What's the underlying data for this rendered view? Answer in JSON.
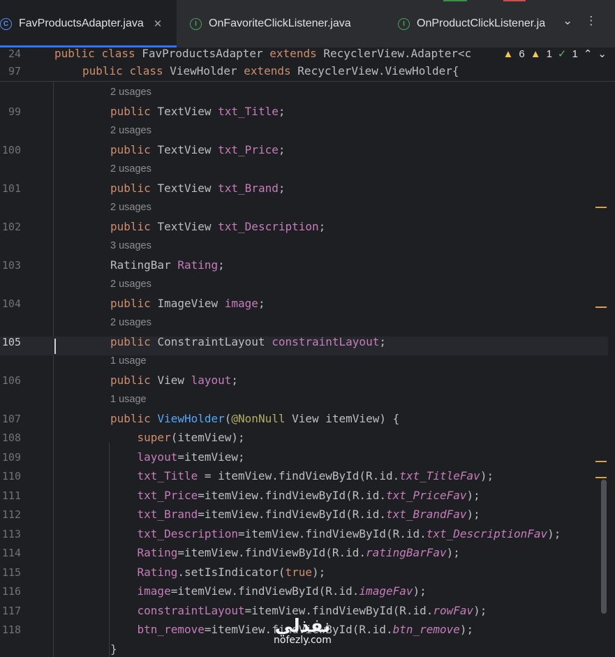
{
  "tabs": [
    {
      "label": "FavProductsAdapter.java",
      "icon": "class-icon",
      "active": true
    },
    {
      "label": "OnFavoriteClickListener.java",
      "icon": "interface-icon"
    },
    {
      "label": "OnProductClickListener.ja",
      "icon": "interface-icon"
    }
  ],
  "tab_icon_class": "C",
  "tab_icon_interface": "I",
  "sticky": [
    {
      "ln": "24",
      "code": "public class FavProductsAdapter extends RecyclerView.Adapter<c"
    },
    {
      "ln": "97",
      "code": "public class ViewHolder extends RecyclerView.ViewHolder{"
    }
  ],
  "inspections": {
    "warnings": "6",
    "weak_warnings": "1",
    "typos": "1"
  },
  "lines": [
    {
      "ln": "",
      "usage": "2 usages"
    },
    {
      "ln": "99",
      "code": [
        [
          "kw",
          "public "
        ],
        [
          "ty",
          "TextView "
        ],
        [
          "fld",
          "txt_Title"
        ],
        [
          "pl",
          ";"
        ]
      ]
    },
    {
      "ln": "",
      "usage": "2 usages"
    },
    {
      "ln": "100",
      "code": [
        [
          "kw",
          "public "
        ],
        [
          "ty",
          "TextView "
        ],
        [
          "fld",
          "txt_Price"
        ],
        [
          "pl",
          ";"
        ]
      ]
    },
    {
      "ln": "",
      "usage": "2 usages"
    },
    {
      "ln": "101",
      "code": [
        [
          "kw",
          "public "
        ],
        [
          "ty",
          "TextView "
        ],
        [
          "fld",
          "txt_Brand"
        ],
        [
          "pl",
          ";"
        ]
      ]
    },
    {
      "ln": "",
      "usage": "2 usages"
    },
    {
      "ln": "102",
      "code": [
        [
          "kw",
          "public "
        ],
        [
          "ty",
          "TextView "
        ],
        [
          "fld",
          "txt_Description"
        ],
        [
          "pl",
          ";"
        ]
      ]
    },
    {
      "ln": "",
      "usage": "3 usages"
    },
    {
      "ln": "103",
      "code": [
        [
          "ty",
          "RatingBar "
        ],
        [
          "fld",
          "Rating"
        ],
        [
          "pl",
          ";"
        ]
      ]
    },
    {
      "ln": "",
      "usage": "2 usages"
    },
    {
      "ln": "104",
      "code": [
        [
          "kw",
          "public "
        ],
        [
          "ty",
          "ImageView "
        ],
        [
          "fld",
          "image"
        ],
        [
          "pl",
          ";"
        ]
      ]
    },
    {
      "ln": "",
      "usage": "2 usages"
    },
    {
      "ln": "105",
      "code": [
        [
          "kw",
          "public "
        ],
        [
          "ty",
          "ConstraintLayout "
        ],
        [
          "fld",
          "constraintLayout"
        ],
        [
          "pl",
          ";"
        ]
      ]
    },
    {
      "ln": "",
      "usage": "1 usage"
    },
    {
      "ln": "106",
      "code": [
        [
          "kw",
          "public "
        ],
        [
          "ty",
          "View "
        ],
        [
          "fld",
          "layout"
        ],
        [
          "pl",
          ";"
        ]
      ]
    },
    {
      "ln": "",
      "usage": "1 usage"
    },
    {
      "ln": "107",
      "code": [
        [
          "kw",
          "public "
        ],
        [
          "fn",
          "ViewHolder"
        ],
        [
          "pl",
          "("
        ],
        [
          "an",
          "@NonNull "
        ],
        [
          "ty",
          "View itemView) {"
        ]
      ]
    },
    {
      "ln": "108",
      "code": [
        [
          "kw",
          "    super"
        ],
        [
          "pl",
          "(itemView);"
        ]
      ]
    },
    {
      "ln": "109",
      "code": [
        [
          "fld",
          "    layout"
        ],
        [
          "pl",
          "=itemView;"
        ]
      ]
    },
    {
      "ln": "110",
      "code": [
        [
          "fld",
          "    txt_Title"
        ],
        [
          "pl",
          " = itemView.findViewById(R.id."
        ],
        [
          "it",
          "txt_TitleFav"
        ],
        [
          "pl",
          ");"
        ]
      ]
    },
    {
      "ln": "111",
      "code": [
        [
          "fld",
          "    txt_Price"
        ],
        [
          "pl",
          "=itemView.findViewById(R.id."
        ],
        [
          "it",
          "txt_PriceFav"
        ],
        [
          "pl",
          ");"
        ]
      ]
    },
    {
      "ln": "112",
      "code": [
        [
          "fld",
          "    txt_Brand"
        ],
        [
          "pl",
          "=itemView.findViewById(R.id."
        ],
        [
          "it",
          "txt_BrandFav"
        ],
        [
          "pl",
          ");"
        ]
      ]
    },
    {
      "ln": "113",
      "code": [
        [
          "fld",
          "    txt_Description"
        ],
        [
          "pl",
          "=itemView.findViewById(R.id."
        ],
        [
          "it",
          "txt_DescriptionFav"
        ],
        [
          "pl",
          ");"
        ]
      ]
    },
    {
      "ln": "114",
      "code": [
        [
          "fld",
          "    Rating"
        ],
        [
          "pl",
          "=itemView.findViewById(R.id."
        ],
        [
          "it",
          "ratingBarFav"
        ],
        [
          "pl",
          ");"
        ]
      ]
    },
    {
      "ln": "115",
      "code": [
        [
          "fld",
          "    Rating"
        ],
        [
          "pl",
          ".setIsIndicator("
        ],
        [
          "kw",
          "true"
        ],
        [
          "pl",
          ");"
        ]
      ]
    },
    {
      "ln": "116",
      "code": [
        [
          "fld",
          "    image"
        ],
        [
          "pl",
          "=itemView.findViewById(R.id."
        ],
        [
          "it",
          "imageFav"
        ],
        [
          "pl",
          ");"
        ]
      ]
    },
    {
      "ln": "117",
      "code": [
        [
          "fld",
          "    constraintLayout"
        ],
        [
          "pl",
          "=itemView.findViewById(R.id."
        ],
        [
          "it",
          "rowFav"
        ],
        [
          "pl",
          ");"
        ]
      ]
    },
    {
      "ln": "118",
      "code": [
        [
          "fld",
          "    btn_remove"
        ],
        [
          "pl",
          "=itemView.findViewById(R.id."
        ],
        [
          "it",
          "btn_remove"
        ],
        [
          "pl",
          ");"
        ]
      ]
    },
    {
      "ln": "",
      "code": [
        [
          "pl",
          "}"
        ]
      ]
    }
  ],
  "watermark": {
    "arabic": "نفذلي",
    "latin": "nofezly.com"
  }
}
